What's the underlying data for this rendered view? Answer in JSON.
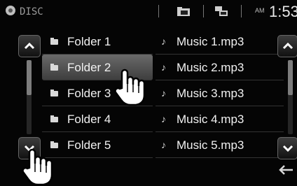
{
  "header": {
    "source": "DISC",
    "am_pm": "AM",
    "clock": "1:53"
  },
  "folders": [
    {
      "label": "Folder 1",
      "selected": false
    },
    {
      "label": "Folder 2",
      "selected": true
    },
    {
      "label": "Folder 3",
      "selected": false
    },
    {
      "label": "Folder 4",
      "selected": false
    },
    {
      "label": "Folder 5",
      "selected": false
    }
  ],
  "files": [
    {
      "label": "Music 1.mp3"
    },
    {
      "label": "Music 2.mp3"
    },
    {
      "label": "Music 3.mp3"
    },
    {
      "label": "Music 4.mp3"
    },
    {
      "label": "Music 5.mp3"
    }
  ],
  "icons": {
    "source": "disc-icon",
    "folder_view": "folder-up-icon",
    "file_view": "folder-list-icon",
    "scroll_up": "chevron-up-icon",
    "scroll_down": "chevron-down-icon",
    "back": "back-arrow-icon",
    "pointer": "hand-pointer-icon",
    "file": "music-note-icon"
  },
  "colors": {
    "background": "#050505",
    "selected_row": "#5a5a5a",
    "text": "#f2f2f2"
  }
}
